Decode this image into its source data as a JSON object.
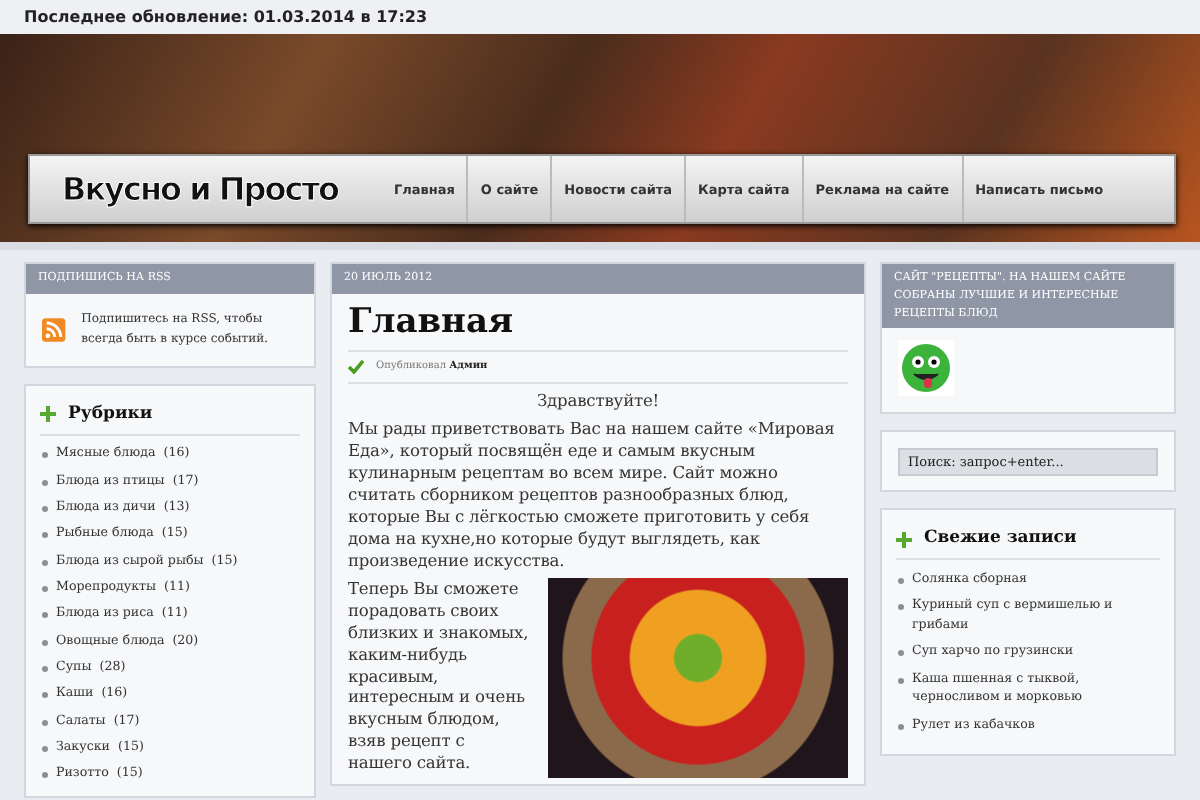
{
  "top_bar": {
    "text": "Последнее обновление: 01.03.2014 в 17:23"
  },
  "header": {
    "logo_text": "Вкусно и Просто",
    "menu": [
      {
        "label": "Главная"
      },
      {
        "label": "О сайте"
      },
      {
        "label": "Новости сайта"
      },
      {
        "label": "Карта сайта"
      },
      {
        "label": "Реклама на сайте"
      },
      {
        "label": "Написать письмо"
      }
    ]
  },
  "left_sidebar": {
    "rss": {
      "title": "ПОДПИШИСЬ НА RSS",
      "text": "Подпишитесь на RSS, чтобы всегда быть в курсе событий."
    },
    "categories": {
      "title": "Рубрики",
      "items": [
        {
          "name": "Мясные блюда",
          "count": "(16)"
        },
        {
          "name": "Блюда из птицы",
          "count": "(17)"
        },
        {
          "name": "Блюда из дичи",
          "count": "(13)"
        },
        {
          "name": "Рыбные блюда",
          "count": "(15)"
        },
        {
          "name": "Блюда из сырой рыбы",
          "count": "(15)"
        },
        {
          "name": "Морепродукты",
          "count": "(11)"
        },
        {
          "name": "Блюда из риса",
          "count": "(11)"
        },
        {
          "name": "Овощные блюда",
          "count": "(20)"
        },
        {
          "name": "Супы",
          "count": "(28)"
        },
        {
          "name": "Каши",
          "count": "(16)"
        },
        {
          "name": "Салаты",
          "count": "(17)"
        },
        {
          "name": "Закуски",
          "count": "(15)"
        },
        {
          "name": "Ризотто",
          "count": "(15)"
        }
      ]
    }
  },
  "post": {
    "date": "20 ИЮЛЬ 2012",
    "title": "Главная",
    "meta": "Опубликовал **Админ**",
    "greeting": "Здравствуйте!",
    "paragraph_1": "Мы рады приветствовать Вас на нашем сайте «Мировая Еда», который посвящён еде и самым вкусным кулинарным рецептам во всем мире. Сайт можно считать сборником рецептов разнообразных блюд, которые Вы с лёгкостью сможете приготовить у себя дома на кухне,но которые будут выглядеть, как произведение искусства.",
    "paragraph_2": "Теперь Вы сможете порадовать своих близких и знакомых, каким-нибудь красивым, интересным и очень вкусным блюдом, взяв рецепт с нашего сайта."
  },
  "right_sidebar": {
    "about": "САЙТ \"РЕЦЕПТЫ\". НА НАШЕМ САЙТЕ СОБРАНЫ ЛУЧШИЕ И ИНТЕРЕСНЫЕ РЕЦЕПТЫ БЛЮД",
    "search": {
      "placeholder": "Поиск: запрос+enter..."
    },
    "recent": {
      "title": "Свежие записи",
      "items": [
        "Солянка сборная",
        "Куриный суп с вермишелью и грибами",
        "Суп харчо по грузински",
        "Каша пшенная с тыквой, черносливом и морковью",
        "Рулет из кабачков"
      ]
    }
  }
}
